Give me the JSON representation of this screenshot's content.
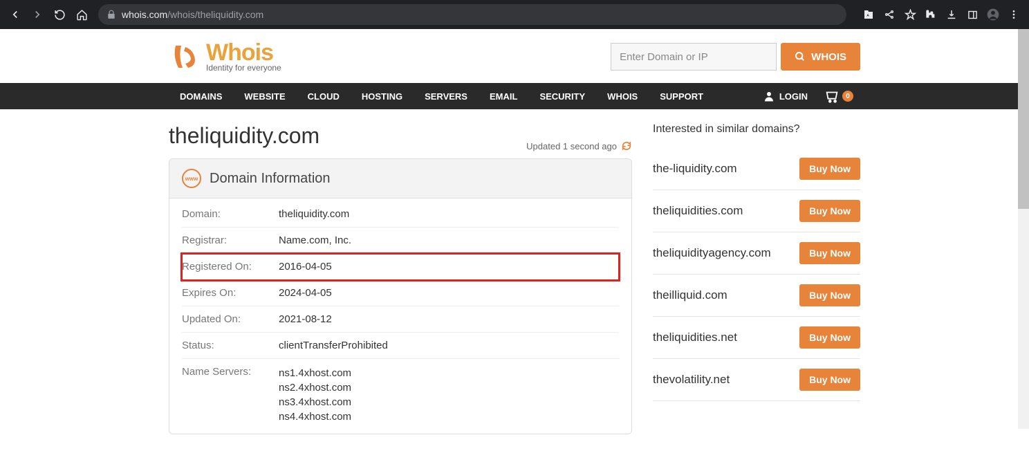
{
  "browser": {
    "url_host": "whois.com",
    "url_path": "/whois/theliquidity.com"
  },
  "logo": {
    "name": "Whois",
    "tagline": "Identity for everyone"
  },
  "search": {
    "placeholder": "Enter Domain or IP",
    "button": "WHOIS"
  },
  "nav": {
    "items": [
      "DOMAINS",
      "WEBSITE",
      "CLOUD",
      "HOSTING",
      "SERVERS",
      "EMAIL",
      "SECURITY",
      "WHOIS",
      "SUPPORT"
    ],
    "login": "LOGIN",
    "cart_count": "0"
  },
  "main": {
    "domain_title": "theliquidity.com",
    "updated": "Updated 1 second ago",
    "card_title": "Domain Information",
    "rows": [
      {
        "label": "Domain:",
        "value": "theliquidity.com"
      },
      {
        "label": "Registrar:",
        "value": "Name.com, Inc."
      },
      {
        "label": "Registered On:",
        "value": "2016-04-05",
        "highlight": true
      },
      {
        "label": "Expires On:",
        "value": "2024-04-05"
      },
      {
        "label": "Updated On:",
        "value": "2021-08-12"
      },
      {
        "label": "Status:",
        "value": "clientTransferProhibited"
      }
    ],
    "nameservers_label": "Name Servers:",
    "nameservers": [
      "ns1.4xhost.com",
      "ns2.4xhost.com",
      "ns3.4xhost.com",
      "ns4.4xhost.com"
    ]
  },
  "sidebar": {
    "title": "Interested in similar domains?",
    "buy_label": "Buy Now",
    "items": [
      "the-liquidity.com",
      "theliquidities.com",
      "theliquidityagency.com",
      "theilliquid.com",
      "theliquidities.net",
      "thevolatility.net"
    ]
  }
}
